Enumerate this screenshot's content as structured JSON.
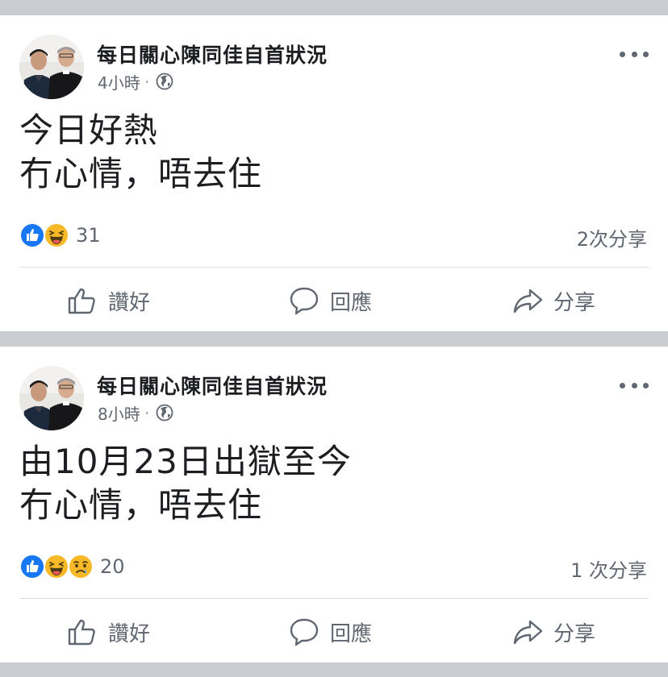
{
  "posts": [
    {
      "page_name": "每日關心陳同佳自首狀況",
      "time": "4小時",
      "separator": "·",
      "privacy_icon": "globe-icon",
      "lines": [
        "今日好熱",
        "冇心情，唔去住"
      ],
      "reactions": [
        "like",
        "haha"
      ],
      "reaction_count": "31",
      "shares": "2次分享"
    },
    {
      "page_name": "每日關心陳同佳自首狀況",
      "time": "8小時",
      "separator": "·",
      "privacy_icon": "globe-icon",
      "lines": [
        "由10月23日出獄至今",
        "冇心情，唔去住"
      ],
      "reactions": [
        "like",
        "haha",
        "sad"
      ],
      "reaction_count": "20",
      "shares": "1 次分享"
    }
  ],
  "actions": {
    "like": "讚好",
    "comment": "回應",
    "share": "分享"
  },
  "colors": {
    "like_blue": "#1877f2",
    "emoji_yellow": "#f7b928",
    "text_gray": "#606770",
    "background": "#c9ccd1"
  }
}
